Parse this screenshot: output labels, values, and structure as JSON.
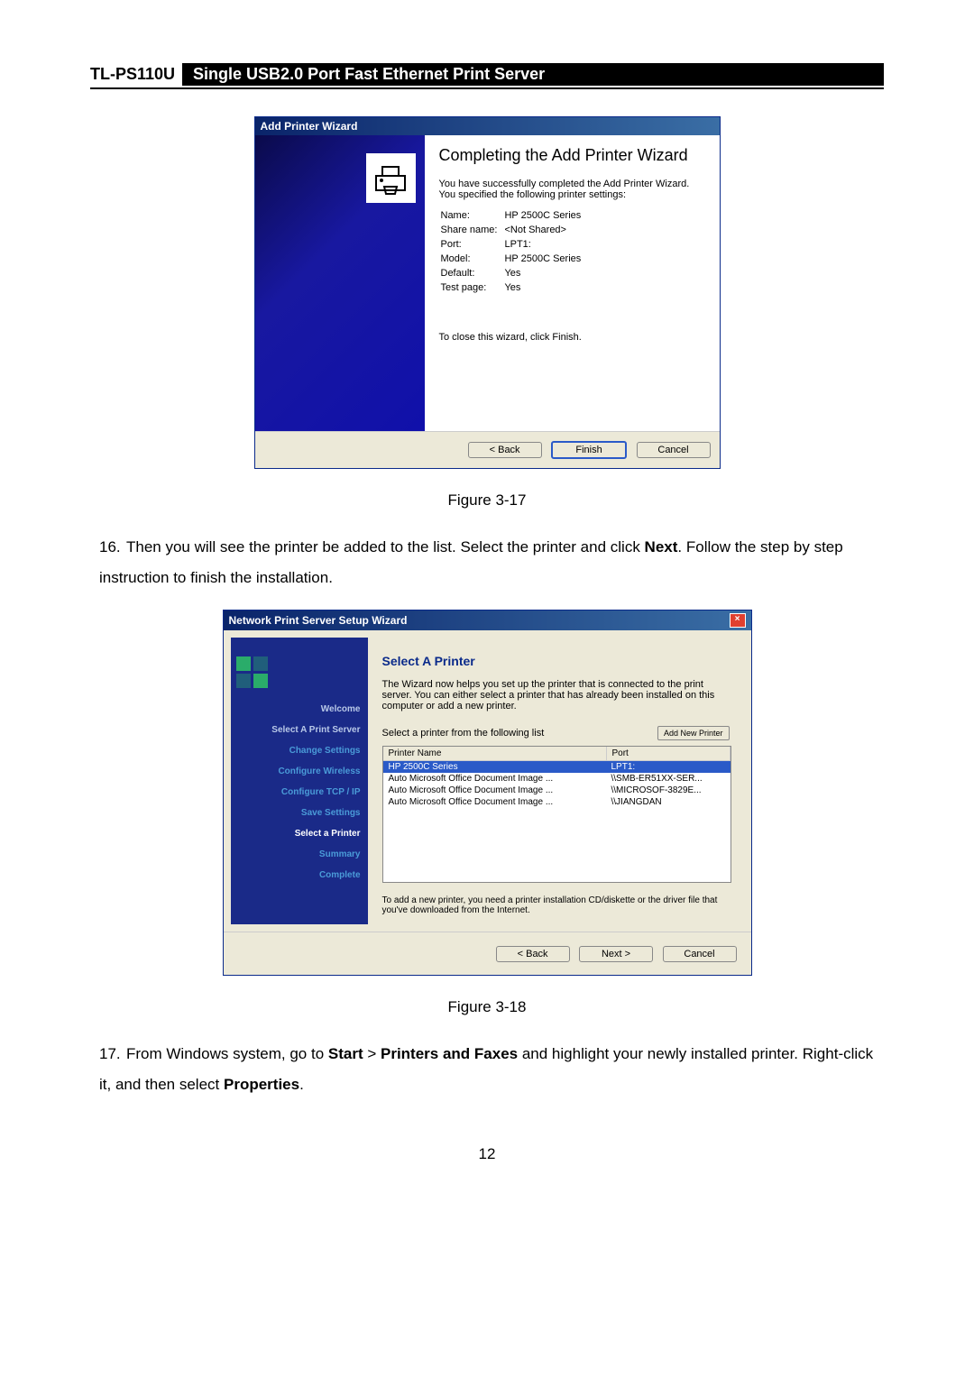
{
  "header": {
    "model": "TL-PS110U",
    "title": "Single USB2.0 Port Fast Ethernet Print Server"
  },
  "wizard1": {
    "title": "Add Printer Wizard",
    "heading": "Completing the Add Printer Wizard",
    "intro": "You have successfully completed the Add Printer Wizard. You specified the following printer settings:",
    "rows": {
      "name_l": "Name:",
      "name_v": "HP 2500C Series",
      "share_l": "Share name:",
      "share_v": "<Not Shared>",
      "port_l": "Port:",
      "port_v": "LPT1:",
      "model_l": "Model:",
      "model_v": "HP 2500C Series",
      "default_l": "Default:",
      "default_v": "Yes",
      "test_l": "Test page:",
      "test_v": "Yes"
    },
    "close_hint": "To close this wizard, click Finish.",
    "buttons": {
      "back": "< Back",
      "finish": "Finish",
      "cancel": "Cancel"
    }
  },
  "fig1_caption": "Figure 3-17",
  "step16_num": "16.",
  "step16_a": "Then you will see the printer be added to the list. Select the printer and click ",
  "step16_bold": "Next",
  "step16_b": ". Follow the step by step instruction to finish the installation.",
  "wizard2": {
    "title": "Network Print Server Setup Wizard",
    "heading": "Select A Printer",
    "intro": "The Wizard now helps you set up the printer that is connected to the print server. You can either select a printer that has already been installed on this computer or add a new printer.",
    "list_label": "Select a printer from the following list",
    "add_btn": "Add New Printer",
    "col1": "Printer Name",
    "col2": "Port",
    "rows": [
      {
        "name": "HP 2500C Series",
        "port": "LPT1:"
      },
      {
        "name": "Auto Microsoft Office Document Image ...",
        "port": "\\\\SMB-ER51XX-SER..."
      },
      {
        "name": "Auto Microsoft Office Document Image ...",
        "port": "\\\\MICROSOF-3829E..."
      },
      {
        "name": "Auto Microsoft Office Document Image ...",
        "port": "\\\\JIANGDAN"
      }
    ],
    "note": "To add a new printer, you need a printer installation CD/diskette or the driver file that you've downloaded from the Internet.",
    "side": {
      "welcome": "Welcome",
      "s1": "Select A Print Server",
      "s2": "Change Settings",
      "s3": "Configure Wireless",
      "s4": "Configure TCP / IP",
      "s5": "Save Settings",
      "s6": "Select a Printer",
      "s7": "Summary",
      "s8": "Complete"
    },
    "buttons": {
      "back": "< Back",
      "next": "Next >",
      "cancel": "Cancel"
    }
  },
  "fig2_caption": "Figure 3-18",
  "step17_num": "17.",
  "step17_a": "From Windows system, go to ",
  "step17_b1": "Start",
  "step17_b2": " > ",
  "step17_b3": "Printers and Faxes",
  "step17_c": " and highlight your newly installed printer. Right-click it, and then select ",
  "step17_b4": "Properties",
  "step17_d": ".",
  "page_num": "12"
}
